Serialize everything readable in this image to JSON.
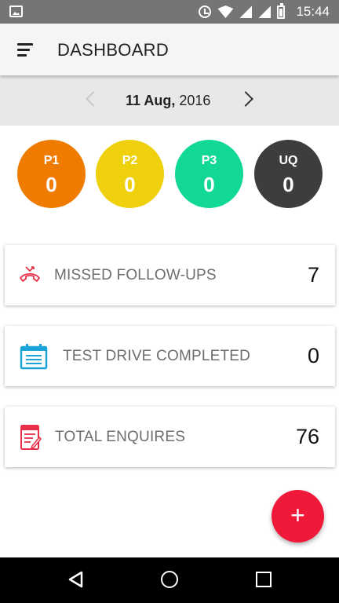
{
  "status_bar": {
    "time": "15:44",
    "signal_label": "R"
  },
  "app_bar": {
    "title": "DASHBOARD"
  },
  "date_nav": {
    "day_month": "11 Aug,",
    "year": " 2016"
  },
  "priorities": [
    {
      "code": "P1",
      "count": "0",
      "color": "#ef7c00"
    },
    {
      "code": "P2",
      "count": "0",
      "color": "#efd00c"
    },
    {
      "code": "P3",
      "count": "0",
      "color": "#11d894"
    },
    {
      "code": "UQ",
      "count": "0",
      "color": "#3d3d3d"
    }
  ],
  "cards": [
    {
      "label": "MISSED FOLLOW-UPS",
      "value": "7",
      "icon": "missed-call-icon",
      "icon_color": "#e8304a"
    },
    {
      "label": "TEST DRIVE COMPLETED",
      "value": "0",
      "icon": "calendar-icon",
      "icon_color": "#1aa3d6"
    },
    {
      "label": "TOTAL ENQUIRES",
      "value": "76",
      "icon": "enquiry-form-icon",
      "icon_color": "#e8304a"
    }
  ],
  "fab": {
    "label": "+",
    "color": "#f0193a"
  }
}
